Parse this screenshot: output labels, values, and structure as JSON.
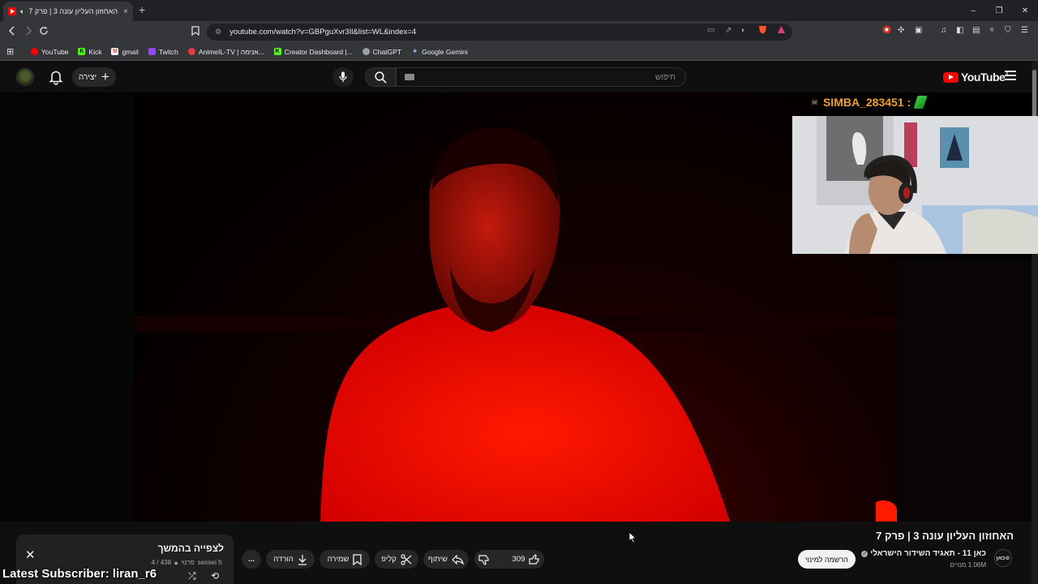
{
  "browser": {
    "tab_title": "האחוזון העליון עונה 3 | פרק 7",
    "tab_close": "×",
    "new_tab": "+",
    "address": "youtube.com/watch?v=GBPguXvr3Il&list=WL&index=4",
    "window_controls": [
      "–",
      "❐",
      "✕"
    ]
  },
  "bookmarks": [
    {
      "label": "YouTube",
      "icon": "youtube-icon",
      "color": "#ff0000"
    },
    {
      "label": "Kick",
      "icon": "kick-icon",
      "color": "#53fc18"
    },
    {
      "label": "gmail",
      "icon": "gmail-icon",
      "color": "#ea4335"
    },
    {
      "label": "Twitch",
      "icon": "twitch-icon",
      "color": "#9146ff"
    },
    {
      "label": "AnimeIL-TV | אנימה...",
      "icon": "animeil-icon",
      "color": "#e23b3b"
    },
    {
      "label": "Creator Dashboard |...",
      "icon": "kick-icon",
      "color": "#53fc18"
    },
    {
      "label": "ChatGPT",
      "icon": "chatgpt-icon",
      "color": "#9aa0a6"
    },
    {
      "label": "Google Gemini",
      "icon": "gemini-icon",
      "color": "#8ab4f8"
    }
  ],
  "youtube": {
    "create_label": "יצירה",
    "search_placeholder": "חיפוש",
    "logo_text": "YouTube",
    "logo_reg": "IL"
  },
  "stream_overlay": {
    "cam_username": "SIMBA_283451 :",
    "latest_subscriber": "Latest Subscriber: liran_r6"
  },
  "video": {
    "title": "האחוזון העליון עונה 3 | פרק 7",
    "channel_avatar": "כאן⊙",
    "channel_name": "כאן 11 - תאגיד השידור הישראלי",
    "subscribers": "1.06M מנויים",
    "subscribe_label": "הרשמה למינוי",
    "like_count": "309",
    "share_label": "שיתוף",
    "clip_label": "קליפ",
    "save_label": "שמירה",
    "download_label": "הורדה",
    "more_label": "..."
  },
  "playlist": {
    "title": "לצפייה בהמשך",
    "owner": "sensei fr",
    "privacy": "פרטי",
    "position": "4 / 438"
  },
  "colors": {
    "accent_red": "#ff0000",
    "username_orange": "#f0a030"
  }
}
